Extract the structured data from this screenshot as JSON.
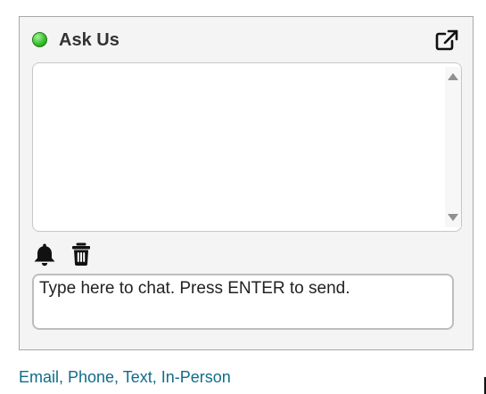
{
  "widget": {
    "title": "Ask Us",
    "status": "online",
    "status_color": "#39c12c",
    "popout_icon": "external-link-icon",
    "chat_log": {
      "messages": []
    },
    "toolbar": {
      "notification_icon": "bell-icon",
      "clear_icon": "trash-icon"
    },
    "input": {
      "placeholder": "Type here to chat. Press ENTER to send.",
      "value": ""
    }
  },
  "footer": {
    "contact_link": "Email, Phone, Text, In-Person",
    "link_color": "#0f6d8a"
  }
}
